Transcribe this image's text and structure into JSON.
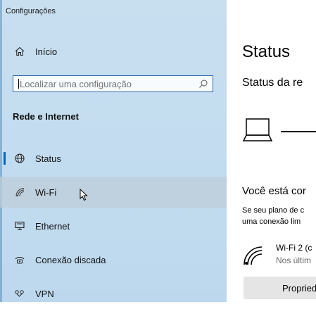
{
  "window": {
    "title": "Configurações"
  },
  "sidebar": {
    "home": {
      "label": "Início",
      "icon": "home-icon"
    },
    "search": {
      "placeholder": "Localizar uma configuração",
      "icon": "search-icon"
    },
    "section_heading": "Rede e Internet",
    "items": [
      {
        "label": "Status",
        "icon": "globe-icon",
        "active": true
      },
      {
        "label": "Wi-Fi",
        "icon": "wifi-icon",
        "hovered": true
      },
      {
        "label": "Ethernet",
        "icon": "ethernet-icon"
      },
      {
        "label": "Conexão discada",
        "icon": "dialup-icon"
      },
      {
        "label": "VPN",
        "icon": "vpn-icon"
      }
    ]
  },
  "main": {
    "title": "Status",
    "subtitle": "Status da re",
    "connected_heading": "Você está cor",
    "connected_desc_line1": "Se seu plano de c",
    "connected_desc_line2": "uma conexão lim",
    "network": {
      "name": "Wi-Fi 2 (c",
      "status": "Nos últim",
      "icon": "wifi-signal-icon"
    },
    "properties_button": "Propried"
  },
  "colors": {
    "accent": "#0067c0",
    "sidebar_bg": "#c3dcef",
    "button_bg": "#e5e5e5"
  }
}
